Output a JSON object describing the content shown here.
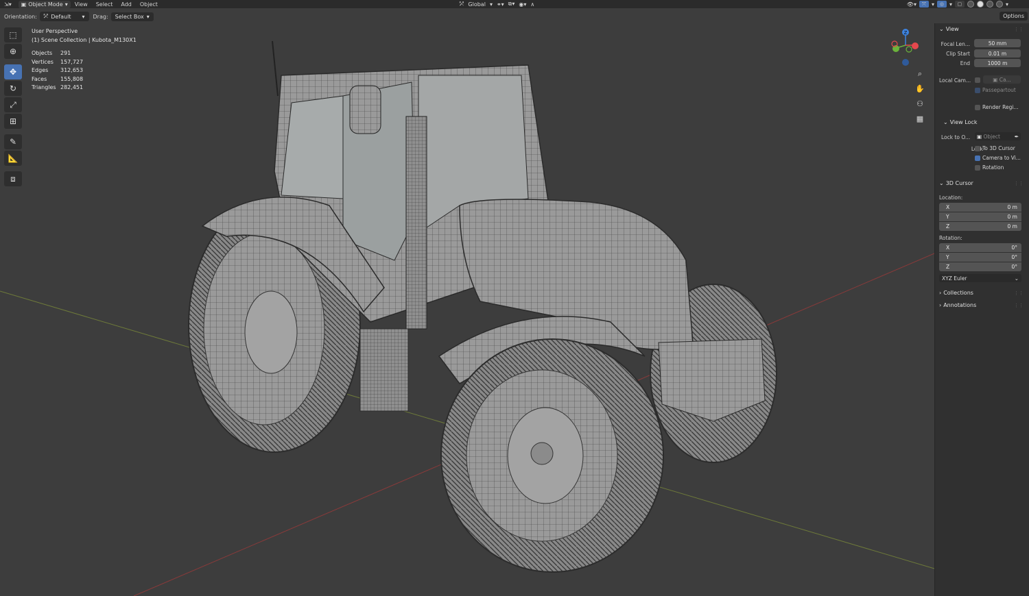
{
  "header": {
    "mode": "Object Mode",
    "menu": [
      "View",
      "Select",
      "Add",
      "Object"
    ],
    "transform_space": "Global"
  },
  "tool_settings": {
    "orientation_label": "Orientation:",
    "orientation_value": "Default",
    "drag_label": "Drag:",
    "drag_value": "Select Box",
    "options_label": "Options"
  },
  "toolbar": {
    "tools": [
      "select-box",
      "cursor",
      "move",
      "rotate",
      "scale",
      "transform",
      "annotate",
      "measure",
      "add-cube"
    ],
    "active": "move"
  },
  "viewport": {
    "view_name": "User Perspective",
    "collection_line": "(1) Scene Collection | Kubota_M130X1",
    "stats": [
      {
        "label": "Objects",
        "value": "291"
      },
      {
        "label": "Vertices",
        "value": "157,727"
      },
      {
        "label": "Edges",
        "value": "312,653"
      },
      {
        "label": "Faces",
        "value": "155,808"
      },
      {
        "label": "Triangles",
        "value": "282,451"
      }
    ],
    "gizmo": {
      "z": "Z",
      "x_color": "#e5484d",
      "y_color": "#6bb33b",
      "z_color": "#3d83e0"
    }
  },
  "sidebar": {
    "view": {
      "title": "View",
      "focal_label": "Focal Len...",
      "focal_value": "50 mm",
      "clip_start_label": "Clip Start",
      "clip_start_value": "0.01 m",
      "end_label": "End",
      "end_value": "1000 m",
      "local_cam_label": "Local Cam...",
      "local_cam_value": "Ca...",
      "passepartout": "Passepartout",
      "render_region": "Render Regi..."
    },
    "view_lock": {
      "title": "View Lock",
      "lock_to_label": "Lock to O...",
      "lock_to_placeholder": "Object",
      "lock_label": "Lock",
      "to_3d_cursor": "To 3D Cursor",
      "camera_to_view": "Camera to Vi...",
      "rotation": "Rotation"
    },
    "cursor": {
      "title": "3D Cursor",
      "location_label": "Location:",
      "location": [
        {
          "axis": "X",
          "value": "0 m"
        },
        {
          "axis": "Y",
          "value": "0 m"
        },
        {
          "axis": "Z",
          "value": "0 m"
        }
      ],
      "rotation_label": "Rotation:",
      "rotation": [
        {
          "axis": "X",
          "value": "0°"
        },
        {
          "axis": "Y",
          "value": "0°"
        },
        {
          "axis": "Z",
          "value": "0°"
        }
      ],
      "rotation_mode": "XYZ Euler"
    },
    "collections": "Collections",
    "annotations": "Annotations"
  },
  "colors": {
    "accent": "#4772b3",
    "grid_red": "#8a3a3a",
    "grid_green": "#5d7a2e"
  }
}
